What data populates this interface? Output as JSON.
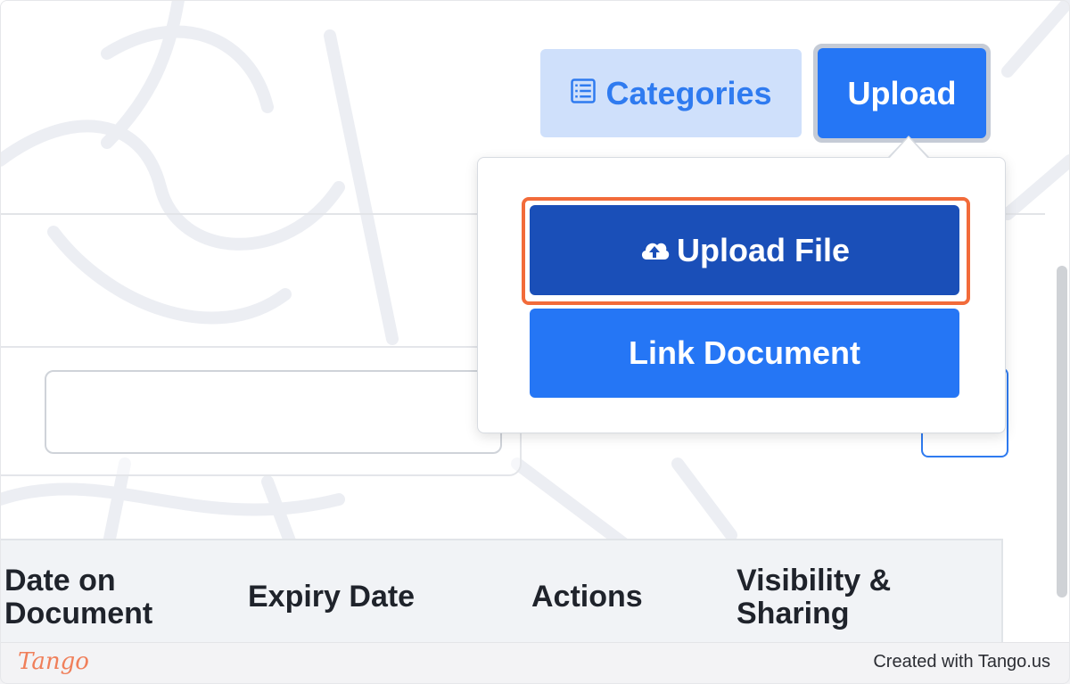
{
  "toolbar": {
    "categories_label": "Categories",
    "upload_label": "Upload"
  },
  "upload_menu": {
    "upload_file_label": "Upload File",
    "link_document_label": "Link Document"
  },
  "table": {
    "headers": [
      "Date on Document",
      "Expiry Date",
      "Actions",
      "Visibility & Sharing"
    ]
  },
  "footer": {
    "logo_text": "Tango",
    "credit_text": "Created with Tango.us"
  },
  "colors": {
    "primary": "#2576f5",
    "primary_dark": "#1a4fb8",
    "secondary_bg": "#cfe0fb",
    "highlight": "#f26b3a"
  },
  "icons": {
    "categories": "list-icon",
    "upload_file": "cloud-upload-icon"
  }
}
